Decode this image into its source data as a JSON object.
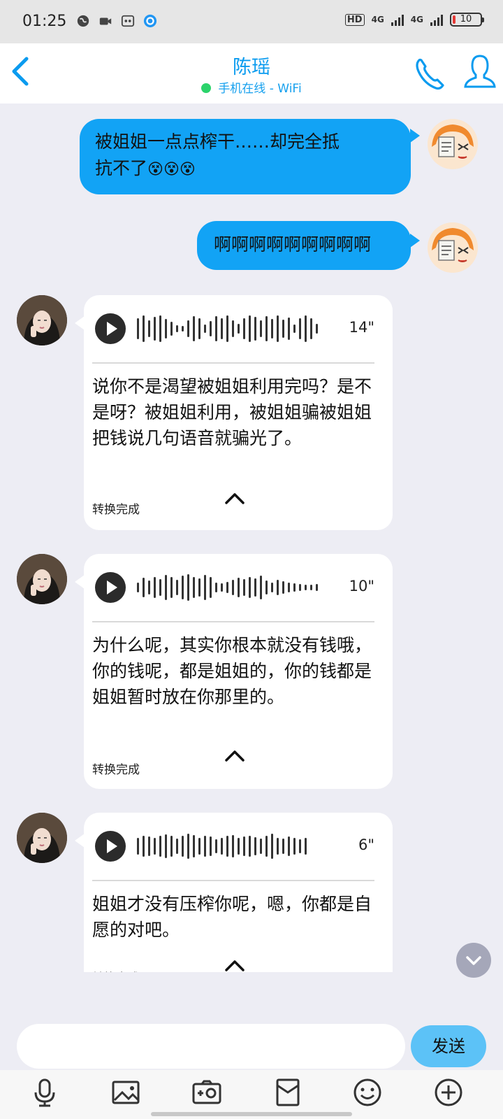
{
  "status_bar": {
    "time": "01:25",
    "battery": "10",
    "network_1": "4G",
    "network_2": "4G",
    "hd": "HD"
  },
  "header": {
    "title": "陈瑶",
    "status": "手机在线 - WiFi"
  },
  "messages": [
    {
      "from": "me",
      "text": "被姐姐一点点榨干……却完全抵",
      "text_line2": "抗不了",
      "emoji": "😵😵😵"
    },
    {
      "from": "me",
      "text": "啊啊啊啊啊啊啊啊啊"
    }
  ],
  "voice_messages": [
    {
      "duration": "14\"",
      "transcript": "说你不是渴望被姐姐利用完吗？是不是呀？被姐姐利用，被姐姐骗被姐姐把钱说几句语音就骗光了。",
      "status": "转换完成"
    },
    {
      "duration": "10\"",
      "transcript": "为什么呢，其实你根本就没有钱哦，你的钱呢，都是姐姐的，你的钱都是姐姐暂时放在你那里的。",
      "status": "转换完成"
    },
    {
      "duration": "6\"",
      "transcript": "姐姐才没有压榨你呢，嗯，你都是自愿的对吧。",
      "status": "转换完成"
    }
  ],
  "composer": {
    "value": "",
    "send_label": "发送"
  },
  "colors": {
    "accent": "#0a9bef",
    "outgoing_bubble": "#12a3f5",
    "online": "#2bd36b",
    "send_button": "#5cc2f7"
  },
  "toolbar_icons": [
    "microphone-icon",
    "image-icon",
    "camera-icon",
    "red-packet-icon",
    "emoji-icon",
    "plus-icon"
  ]
}
